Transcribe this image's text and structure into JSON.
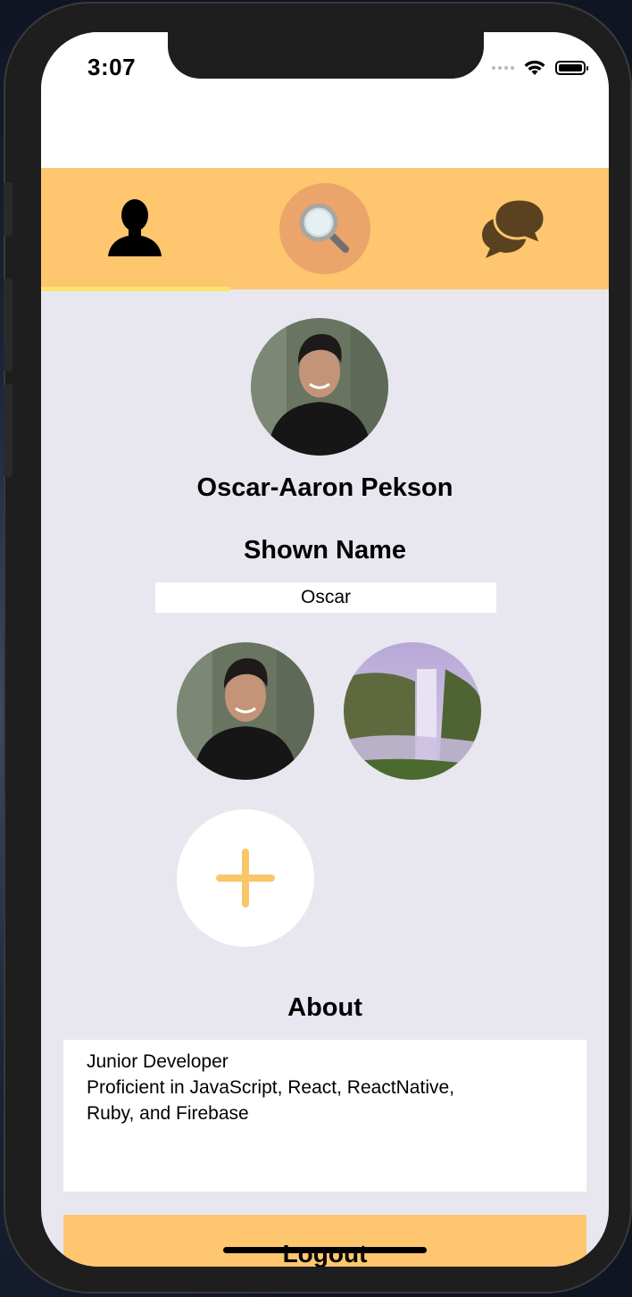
{
  "status_bar": {
    "time": "3:07"
  },
  "tabs": [
    {
      "icon": "person-icon",
      "selected": true
    },
    {
      "icon": "search-icon",
      "selected": false
    },
    {
      "icon": "chat-bubbles-icon",
      "selected": false
    }
  ],
  "profile": {
    "name": "Oscar-Aaron Pekson",
    "shown_name_label": "Shown Name",
    "shown_name_value": "Oscar",
    "about_label": "About",
    "about_text": "Junior Developer\nProficient in JavaScript, React, ReactNative,\nRuby, and Firebase"
  },
  "photos": [
    {
      "icon": "profile-photo-portrait"
    },
    {
      "icon": "photo-waterfall"
    }
  ],
  "logout_label": "Logout",
  "colors": {
    "accent": "#fec66e",
    "tab_indicator": "#fde36a",
    "search_bubble": "#eba46a",
    "background": "#e8e7ef",
    "chat_icon": "#5a4220",
    "plus": "#f9c66a"
  }
}
